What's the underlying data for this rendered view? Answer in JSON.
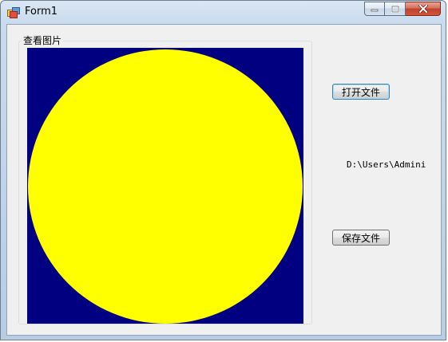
{
  "window": {
    "title": "Form1",
    "icon": "winforms-app-icon",
    "controls": {
      "minimize": "minimize-icon",
      "maximize": "maximize-icon",
      "close": "close-icon"
    }
  },
  "group": {
    "label": "查看图片"
  },
  "picture": {
    "background_color": "#000080",
    "shape_color": "#ffff00",
    "shape": "circle"
  },
  "buttons": {
    "open_label": "打开文件",
    "save_label": "保存文件"
  },
  "path_label": "D:\\Users\\Admini"
}
